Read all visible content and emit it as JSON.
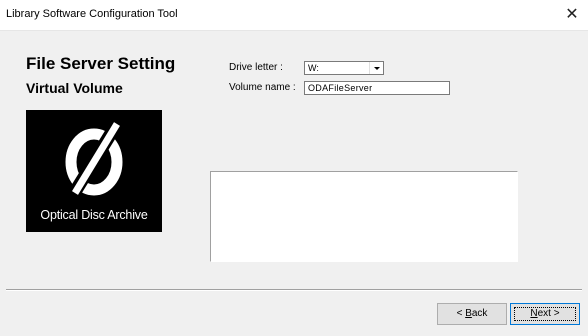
{
  "window": {
    "title": "Library Software Configuration Tool",
    "close_glyph": "✕"
  },
  "page": {
    "heading": "File Server Setting",
    "subheading": "Virtual Volume"
  },
  "logo": {
    "text": "Optical Disc Archive"
  },
  "form": {
    "drive_letter_label": "Drive letter :",
    "drive_letter_value": "W:",
    "volume_name_label": "Volume name :",
    "volume_name_value": "ODAFileServer"
  },
  "buttons": {
    "back_prefix": "< ",
    "back_mnemonic": "B",
    "back_rest": "ack",
    "next_mnemonic": "N",
    "next_rest": "ext >"
  },
  "colors": {
    "background": "#f0f0f0",
    "focus_border": "#0078d7"
  }
}
